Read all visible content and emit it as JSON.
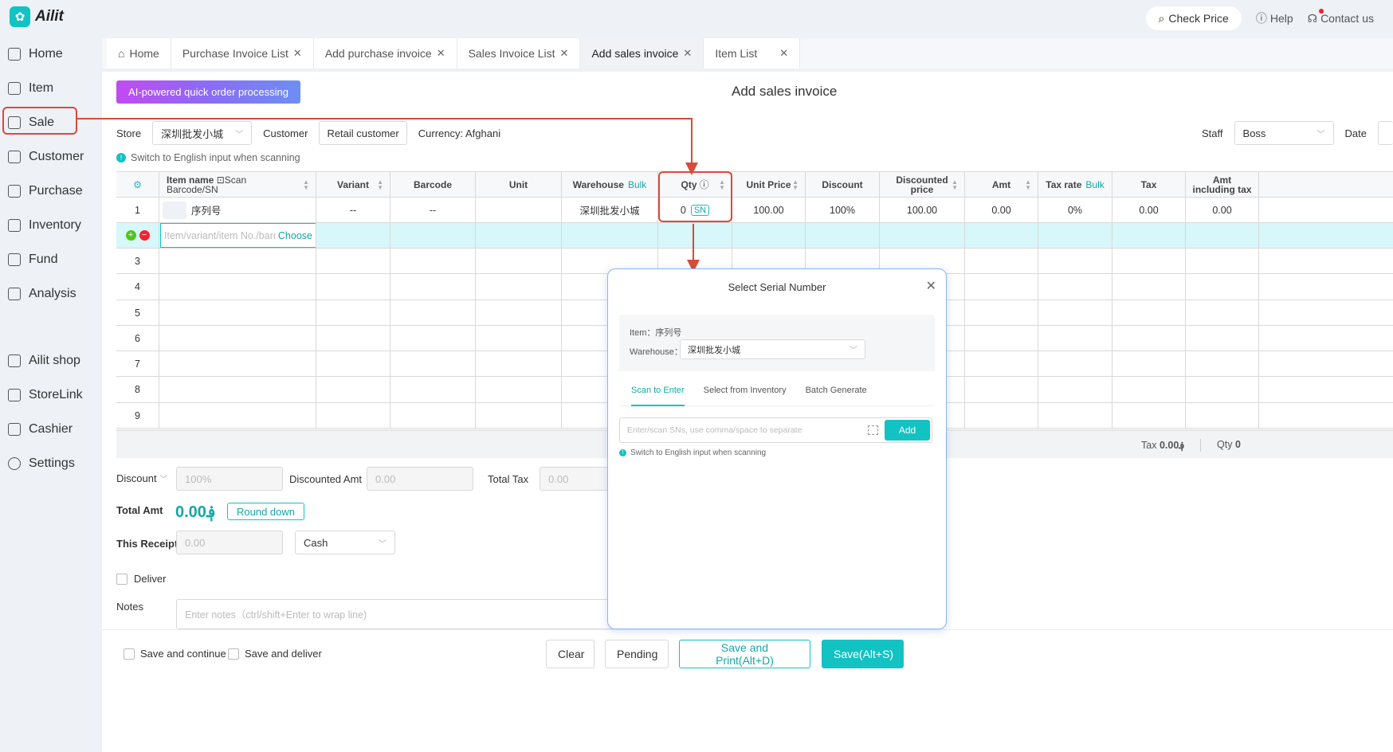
{
  "app": {
    "name": "Ailit"
  },
  "topbar": {
    "check_price": "Check Price",
    "help": "Help",
    "contact": "Contact us"
  },
  "sidebar": {
    "items": [
      {
        "label": "Home",
        "icon": "home-icon"
      },
      {
        "label": "Item",
        "icon": "item-icon"
      },
      {
        "label": "Sale",
        "icon": "sale-icon"
      },
      {
        "label": "Customer",
        "icon": "customer-icon"
      },
      {
        "label": "Purchase",
        "icon": "purchase-icon"
      },
      {
        "label": "Inventory",
        "icon": "inventory-icon"
      },
      {
        "label": "Fund",
        "icon": "fund-icon"
      },
      {
        "label": "Analysis",
        "icon": "analysis-icon"
      },
      {
        "label": "Ailit shop",
        "icon": "shop-icon"
      },
      {
        "label": "StoreLink",
        "icon": "storelink-icon"
      },
      {
        "label": "Cashier",
        "icon": "cashier-icon"
      },
      {
        "label": "Settings",
        "icon": "settings-icon"
      }
    ]
  },
  "tabs": [
    {
      "label": "Home"
    },
    {
      "label": "Purchase Invoice List"
    },
    {
      "label": "Add purchase invoice"
    },
    {
      "label": "Sales Invoice List"
    },
    {
      "label": "Add sales invoice"
    },
    {
      "label": "Item List"
    }
  ],
  "page": {
    "ai_button": "AI-powered quick order processing",
    "title": "Add sales invoice",
    "store_label": "Store",
    "store_value": "深圳批发小城",
    "customer_label": "Customer",
    "customer_value": "Retail customer",
    "currency": "Currency: Afghani",
    "staff_label": "Staff",
    "staff_value": "Boss",
    "date_label": "Date",
    "hint": "Switch to English input when scanning"
  },
  "table": {
    "headers": {
      "item_name": "Item name",
      "scan": "Scan",
      "barcode_sn": "Barcode/SN",
      "variant": "Variant",
      "barcode": "Barcode",
      "unit": "Unit",
      "warehouse": "Warehouse",
      "bulk": "Bulk",
      "qty": "Qty",
      "unit_price": "Unit Price",
      "discount": "Discount",
      "discounted_price": "Discounted price",
      "amt": "Amt",
      "tax_rate": "Tax rate",
      "tax": "Tax",
      "amt_incl_tax": "Amt including tax"
    },
    "row1": {
      "no": "1",
      "item": "序列号",
      "variant": "--",
      "barcode": "--",
      "unit": "",
      "warehouse": "深圳批发小城",
      "qty": "0",
      "sn": "SN",
      "unit_price": "100.00",
      "discount": "100%",
      "discounted_price": "100.00",
      "amt": "0.00",
      "tax_rate": "0%",
      "tax": "0.00",
      "amt_incl_tax": "0.00"
    },
    "edit_placeholder": "Item/variant/item No./barcode",
    "choose": "Choose",
    "row_numbers": [
      "3",
      "4",
      "5",
      "6",
      "7",
      "8",
      "9"
    ],
    "summary": {
      "tax_label": "Tax",
      "tax_value": "0.00؋",
      "qty_label": "Qty",
      "qty_value": "0"
    }
  },
  "bottom": {
    "discount_label": "Discount",
    "discount_value": "100%",
    "discounted_amt_label": "Discounted Amt",
    "discounted_amt_value": "0.00",
    "total_tax_label": "Total Tax",
    "total_tax_value": "0.00",
    "total_amt_label": "Total Amt",
    "total_amt_value": "0.00؋",
    "round_down": "Round down",
    "receipt_label": "This Receipt",
    "receipt_value": "0.00",
    "payment_method": "Cash",
    "deliver_label": "Deliver",
    "notes_label": "Notes",
    "notes_placeholder": "Enter notes（ctrl/shift+Enter to wrap line)"
  },
  "footer": {
    "save_continue": "Save and continue",
    "save_deliver": "Save and deliver",
    "clear": "Clear",
    "pending": "Pending",
    "save_print": "Save and Print(Alt+D)",
    "save": "Save(Alt+S)"
  },
  "modal": {
    "title": "Select Serial Number",
    "item_line": "Item：序列号",
    "warehouse_label": "Warehouse：",
    "warehouse_value": "深圳批发小城",
    "tabs": [
      "Scan to Enter",
      "Select from Inventory",
      "Batch Generate"
    ],
    "input_placeholder": "Enter/scan SNs, use comma/space to separate",
    "add": "Add",
    "hint": "Switch to English input when scanning"
  },
  "colors": {
    "accent": "#13c2c2",
    "annotation": "#d94b3a"
  }
}
